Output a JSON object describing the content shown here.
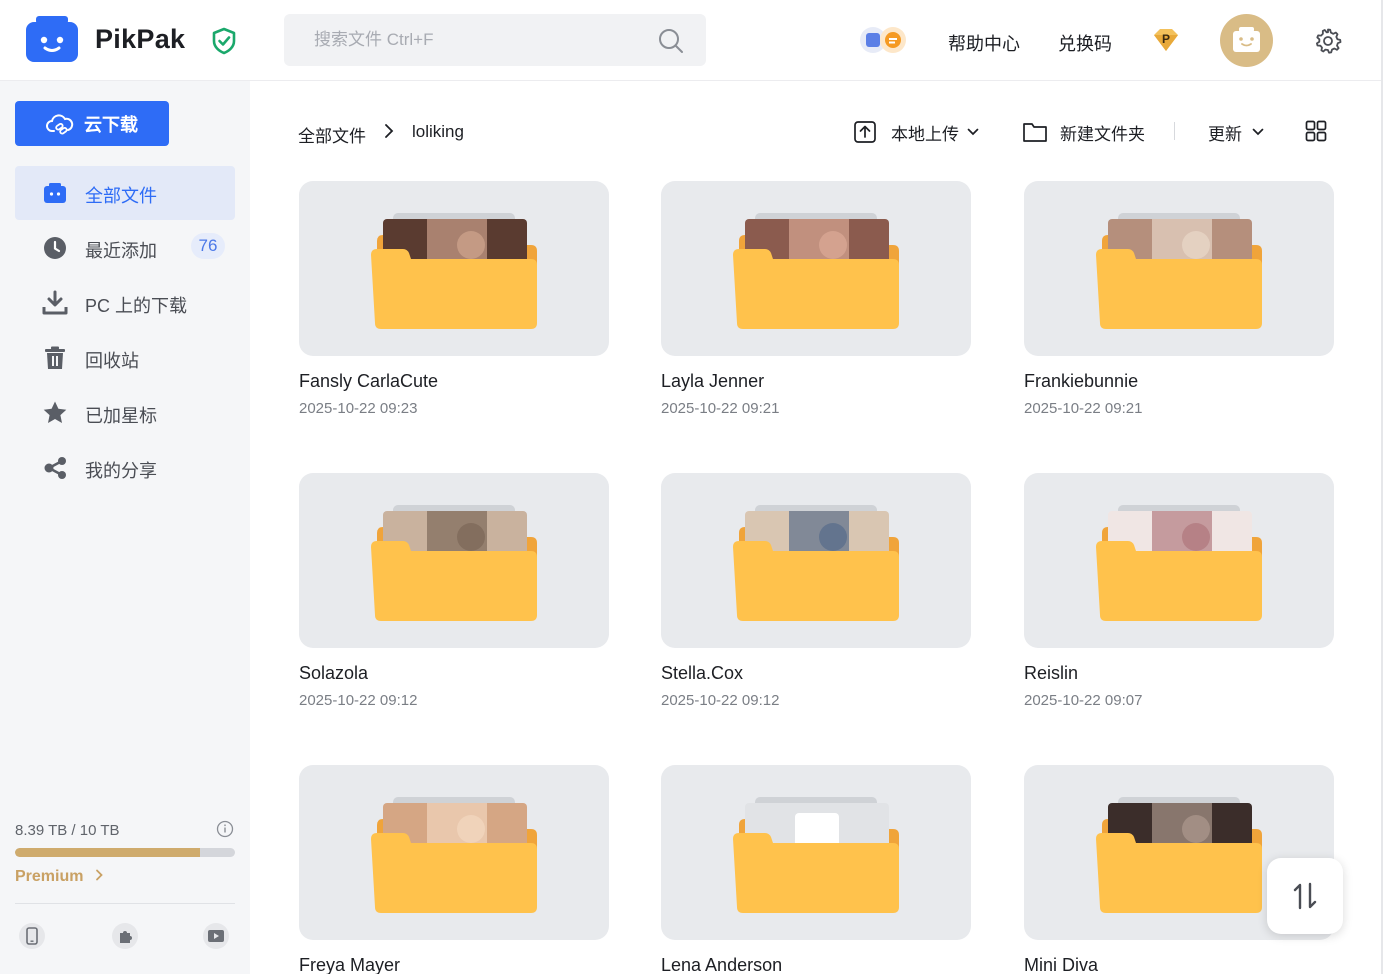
{
  "app": {
    "name": "PikPak",
    "brand_color": "#2E6CF6",
    "folder_color": "#FFC247",
    "premium_color": "#C9A164"
  },
  "header": {
    "search_placeholder": "搜索文件 Ctrl+F",
    "help_center": "帮助中心",
    "redeem_code": "兑换码",
    "premium_badge_letter": "P",
    "icons": [
      "search-icon",
      "promo-icon",
      "premium-badge-icon",
      "avatar",
      "gear-icon",
      "shield-check-icon"
    ]
  },
  "sidebar": {
    "cloud_download": "云下载",
    "items": [
      {
        "label": "全部文件",
        "icon": "folder-icon",
        "active": true
      },
      {
        "label": "最近添加",
        "icon": "clock-icon",
        "badge": "76"
      },
      {
        "label": "PC 上的下载",
        "icon": "download-icon"
      },
      {
        "label": "回收站",
        "icon": "trash-icon"
      },
      {
        "label": "已加星标",
        "icon": "star-icon"
      },
      {
        "label": "我的分享",
        "icon": "share-icon"
      }
    ],
    "storage": {
      "text": "8.39 TB / 10 TB",
      "used_fraction": 0.839
    },
    "premium_link": "Premium",
    "footer_icons": [
      "phone-icon",
      "puzzle-icon",
      "video-icon"
    ]
  },
  "toolbar": {
    "breadcrumb_root": "全部文件",
    "breadcrumb_current": "loliking",
    "upload": "本地上传",
    "new_folder": "新建文件夹",
    "sort": "更新"
  },
  "folders": [
    {
      "name": "Fansly CarlaCute",
      "date": "2025-10-22 09:23"
    },
    {
      "name": "Layla Jenner",
      "date": "2025-10-22 09:21"
    },
    {
      "name": "Frankiebunnie",
      "date": "2025-10-22 09:21"
    },
    {
      "name": "Solazola",
      "date": "2025-10-22 09:12"
    },
    {
      "name": "Stella.Cox",
      "date": "2025-10-22 09:12"
    },
    {
      "name": "Reislin",
      "date": "2025-10-22 09:07"
    },
    {
      "name": "Freya Mayer",
      "date": ""
    },
    {
      "name": "Lena Anderson",
      "date": ""
    },
    {
      "name": "Mini Diva",
      "date": ""
    }
  ]
}
